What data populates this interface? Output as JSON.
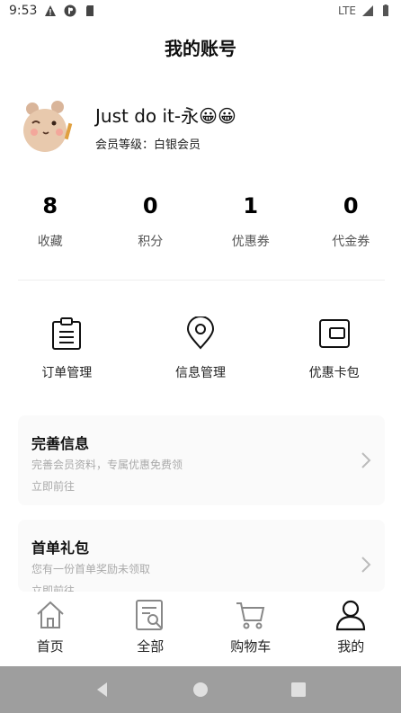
{
  "status_bar": {
    "time": "9:53",
    "network": "LTE"
  },
  "title": "我的账号",
  "profile": {
    "name": "Just do it-永😀😀",
    "level": "会员等级：白银会员"
  },
  "stats": [
    {
      "value": "8",
      "label": "收藏"
    },
    {
      "value": "0",
      "label": "积分"
    },
    {
      "value": "1",
      "label": "优惠券"
    },
    {
      "value": "0",
      "label": "代金券"
    }
  ],
  "quick_actions": [
    {
      "label": "订单管理",
      "icon": "clipboard-icon"
    },
    {
      "label": "信息管理",
      "icon": "location-pin-icon"
    },
    {
      "label": "优惠卡包",
      "icon": "wallet-icon"
    }
  ],
  "cards": [
    {
      "title": "完善信息",
      "desc": "完善会员资料，专属优惠免费领",
      "link": "立即前往"
    },
    {
      "title": "首单礼包",
      "desc": "您有一份首单奖励未领取",
      "link": "立即前往"
    }
  ],
  "tabs": [
    {
      "label": "首页",
      "icon": "home-icon"
    },
    {
      "label": "全部",
      "icon": "catalog-search-icon"
    },
    {
      "label": "购物车",
      "icon": "cart-icon"
    },
    {
      "label": "我的",
      "icon": "user-icon",
      "active": true
    }
  ],
  "colors": {
    "accent": "#000000",
    "muted": "#aaaaaa",
    "card_bg": "#fafafa",
    "nav_bar": "#9e9e9e"
  }
}
